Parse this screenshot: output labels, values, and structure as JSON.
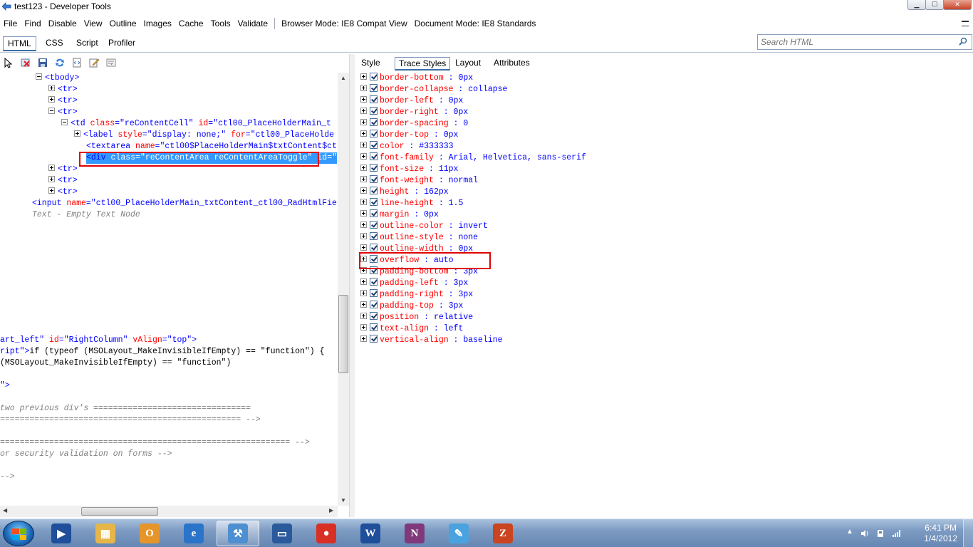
{
  "window": {
    "title": "test123 - Developer Tools"
  },
  "menu": {
    "items": [
      "File",
      "Find",
      "Disable",
      "View",
      "Outline",
      "Images",
      "Cache",
      "Tools",
      "Validate"
    ],
    "browser_mode": "Browser Mode: IE8 Compat View",
    "document_mode": "Document Mode: IE8 Standards"
  },
  "tabs": [
    "HTML",
    "CSS",
    "Script",
    "Profiler"
  ],
  "search": {
    "placeholder": "Search HTML"
  },
  "right_tabs": [
    "Style",
    "Trace Styles",
    "Layout",
    "Attributes"
  ],
  "tree": {
    "tbody": "<tbody>",
    "tr": "<tr>",
    "td": {
      "open": "<td ",
      "class_attr": "class",
      "class_val": "\"reContentCell\"",
      "id_attr": "id",
      "id_val": "\"ctl00_PlaceHolderMain_t"
    },
    "label": {
      "open": "<label ",
      "style_attr": "style",
      "style_val": "\"display: none;\"",
      "for_attr": "for",
      "for_val": "\"ctl00_PlaceHolde"
    },
    "textarea": {
      "open": "<textarea ",
      "name_attr": "name",
      "name_val": "\"ctl00$PlaceHolderMain$txtContent$ct"
    },
    "div": {
      "open": "<div ",
      "class_attr": "class",
      "class_val": "\"reContentArea reContentAreaToggle\"",
      "id_attr": "id=\""
    },
    "input": {
      "open": "<input ",
      "name_attr": "name",
      "name_val": "\"ctl00_PlaceHolderMain_txtContent_ctl00_RadHtmlFie"
    },
    "empty_text": "Text - Empty Text Node",
    "l1_val": "art_left\"",
    "l1_attr": "id",
    "l1_val2": "\"RightColumn\"",
    "l1_attr2": "vAlign",
    "l1_val3": "\"top\">",
    "l2_val": "ript\">",
    "l2_txt": "if (typeof (MSOLayout_MakeInvisibleIfEmpty) == \"function\") {",
    "l3_txt": "(MSOLayout_MakeInvisibleIfEmpty) == \"function\")",
    "l4_txt": "\">",
    "c1": "two previous div's ================================",
    "c2": "================================================= -->",
    "c3": "===========================================================  -->",
    "c4": "or security validation on forms  -->",
    "c5": " -->"
  },
  "styles": [
    {
      "name": "border-bottom",
      "value": "0px"
    },
    {
      "name": "border-collapse",
      "value": "collapse"
    },
    {
      "name": "border-left",
      "value": "0px"
    },
    {
      "name": "border-right",
      "value": "0px"
    },
    {
      "name": "border-spacing",
      "value": "0"
    },
    {
      "name": "border-top",
      "value": "0px"
    },
    {
      "name": "color",
      "value": "#333333"
    },
    {
      "name": "font-family",
      "value": "Arial, Helvetica, sans-serif"
    },
    {
      "name": "font-size",
      "value": "11px"
    },
    {
      "name": "font-weight",
      "value": "normal"
    },
    {
      "name": "height",
      "value": "162px"
    },
    {
      "name": "line-height",
      "value": "1.5"
    },
    {
      "name": "margin",
      "value": "0px"
    },
    {
      "name": "outline-color",
      "value": "invert"
    },
    {
      "name": "outline-style",
      "value": "none"
    },
    {
      "name": "outline-width",
      "value": "0px"
    },
    {
      "name": "overflow",
      "value": "auto"
    },
    {
      "name": "padding-bottom",
      "value": "3px"
    },
    {
      "name": "padding-left",
      "value": "3px"
    },
    {
      "name": "padding-right",
      "value": "3px"
    },
    {
      "name": "padding-top",
      "value": "3px"
    },
    {
      "name": "position",
      "value": "relative"
    },
    {
      "name": "text-align",
      "value": "left"
    },
    {
      "name": "vertical-align",
      "value": "baseline"
    }
  ],
  "style_separator": " : ",
  "clock": {
    "time": "6:41 PM",
    "date": "1/4/2012"
  },
  "taskbar_apps": [
    {
      "name": "media-player",
      "color": "#1f4e9a"
    },
    {
      "name": "explorer",
      "color": "#e6b64a"
    },
    {
      "name": "outlook",
      "color": "#e5952a"
    },
    {
      "name": "internet-explorer",
      "color": "#2a74c9"
    },
    {
      "name": "developer-tools",
      "color": "#4d8fd1"
    },
    {
      "name": "remote-desktop",
      "color": "#2b5a9c"
    },
    {
      "name": "chrome",
      "color": "#d93025"
    },
    {
      "name": "word",
      "color": "#1f4e9a"
    },
    {
      "name": "onenote",
      "color": "#80397b"
    },
    {
      "name": "paint",
      "color": "#4aa3df"
    },
    {
      "name": "filezilla",
      "color": "#c9441f"
    }
  ]
}
